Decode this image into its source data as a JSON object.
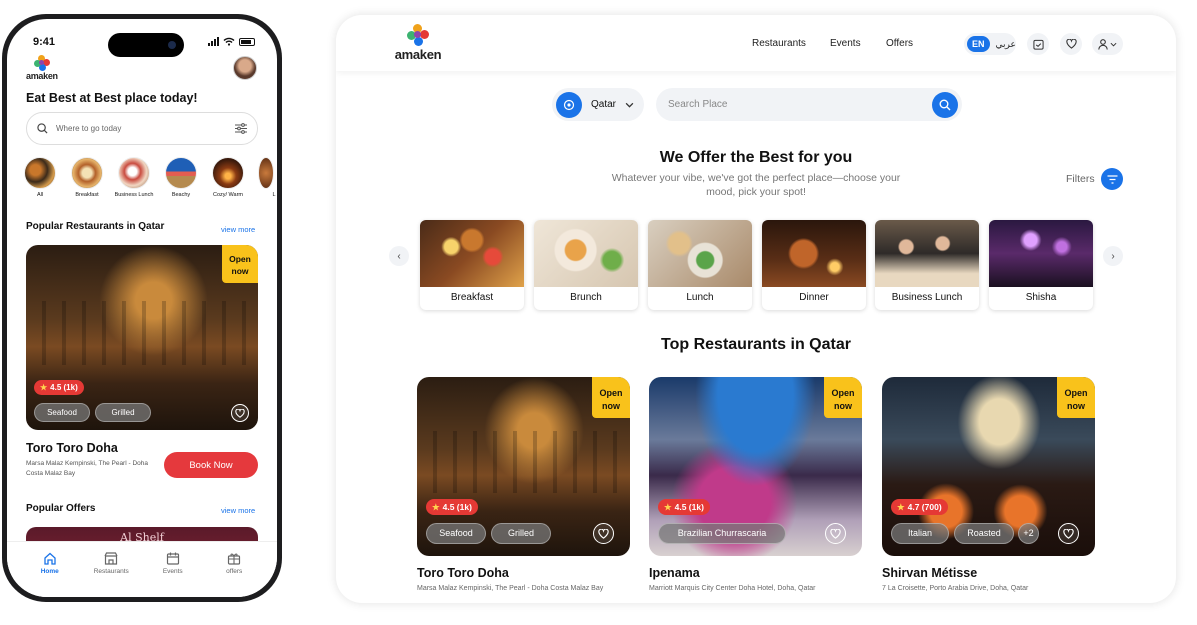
{
  "colors": {
    "accent": "#1a73e8",
    "open": "#f9c21b",
    "rating": "#e53935",
    "book": "#e5393d"
  },
  "phone": {
    "time": "9:41",
    "logo": "amaken",
    "heading": "Eat Best at Best place today!",
    "search_placeholder": "Where to go today",
    "categories": [
      "All",
      "Breakfast",
      "Business Lunch",
      "Beachy",
      "Cozy/ Warm",
      "L"
    ],
    "popular_title": "Popular Restaurants in Qatar",
    "view_more": "view more",
    "card": {
      "open": "Open now",
      "rating": "4.5 (1k)",
      "tags": [
        "Seafood",
        "Grilled"
      ]
    },
    "restaurant_name": "Toro Toro Doha",
    "restaurant_address": "Marsa Malaz Kempinski, The Pearl - Doha Costa Malaz Bay",
    "book_now": "Book Now",
    "offers_title": "Popular Offers",
    "offers_view_more": "view more",
    "offer_banner": "Al Shelf",
    "tabs": [
      "Home",
      "Restaurants",
      "Events",
      "offers"
    ]
  },
  "web": {
    "logo": "amaken",
    "nav": [
      "Restaurants",
      "Events",
      "Offers"
    ],
    "lang_en": "EN",
    "lang_ar": "عربي",
    "location": "Qatar",
    "search_placeholder": "Search Place",
    "offer_title": "We Offer the Best for you",
    "offer_sub": "Whatever your vibe, we've got the perfect place—choose your mood, pick your spot!",
    "filters": "Filters",
    "meals": [
      "Breakfast",
      "Brunch",
      "Lunch",
      "Dinner",
      "Business Lunch",
      "Shisha"
    ],
    "top_title": "Top Restaurants in Qatar",
    "restaurants": [
      {
        "open": "Open now",
        "rating": "4.5 (1k)",
        "tags": [
          "Seafood",
          "Grilled"
        ],
        "name": "Toro Toro Doha",
        "address": "Marsa Malaz Kempinski, The Pearl - Doha Costa Malaz Bay"
      },
      {
        "open": "Open now",
        "rating": "4.5 (1k)",
        "tags": [
          "Brazilian Churrascaria"
        ],
        "name": "Ipenama",
        "address": "Marriott Marquis City Center Doha Hotel, Doha, Qatar"
      },
      {
        "open": "Open now",
        "rating": "4.7 (700)",
        "tags": [
          "Italian",
          "Roasted"
        ],
        "more": "+2",
        "name": "Shirvan Métisse",
        "address": "7 La Croisette, Porto Arabia Drive, Doha, Qatar"
      }
    ]
  }
}
